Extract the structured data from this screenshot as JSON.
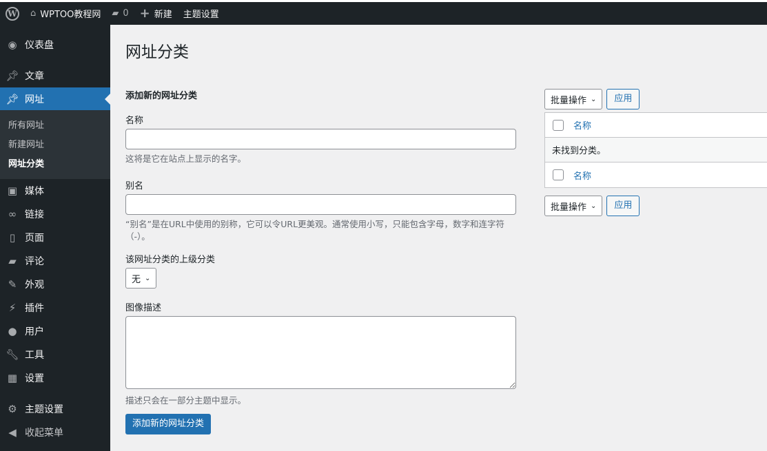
{
  "adminbar": {
    "site_name": "WPTOO教程网",
    "comments_count": "0",
    "new_label": "新建",
    "theme_settings": "主题设置"
  },
  "sidebar": {
    "items": [
      {
        "label": "仪表盘",
        "icon": "dashboard-icon"
      },
      {
        "label": "文章",
        "icon": "pin-icon"
      },
      {
        "label": "网址",
        "icon": "pin-icon"
      },
      {
        "label": "媒体",
        "icon": "media-icon"
      },
      {
        "label": "链接",
        "icon": "link-icon"
      },
      {
        "label": "页面",
        "icon": "page-icon"
      },
      {
        "label": "评论",
        "icon": "comment-icon"
      },
      {
        "label": "外观",
        "icon": "brush-icon"
      },
      {
        "label": "插件",
        "icon": "plugin-icon"
      },
      {
        "label": "用户",
        "icon": "user-icon"
      },
      {
        "label": "工具",
        "icon": "wrench-icon"
      },
      {
        "label": "设置",
        "icon": "settings-icon"
      },
      {
        "label": "主题设置",
        "icon": "gear-icon"
      },
      {
        "label": "收起菜单",
        "icon": "collapse-icon"
      }
    ],
    "submenu": [
      "所有网址",
      "新建网址",
      "网址分类"
    ]
  },
  "page": {
    "title": "网址分类"
  },
  "form": {
    "heading": "添加新的网址分类",
    "name_label": "名称",
    "name_value": "",
    "name_desc": "这将是它在站点上显示的名字。",
    "slug_label": "别名",
    "slug_value": "",
    "slug_desc": "“别名”是在URL中使用的别称，它可以令URL更美观。通常使用小写，只能包含字母，数字和连字符（-）。",
    "parent_label": "该网址分类的上级分类",
    "parent_value": "无",
    "desc_label": "图像描述",
    "desc_value": "",
    "desc_help": "描述只会在一部分主题中显示。",
    "submit": "添加新的网址分类"
  },
  "table": {
    "bulk_action": "批量操作",
    "apply": "应用",
    "column_name": "名称",
    "empty": "未找到分类。"
  }
}
